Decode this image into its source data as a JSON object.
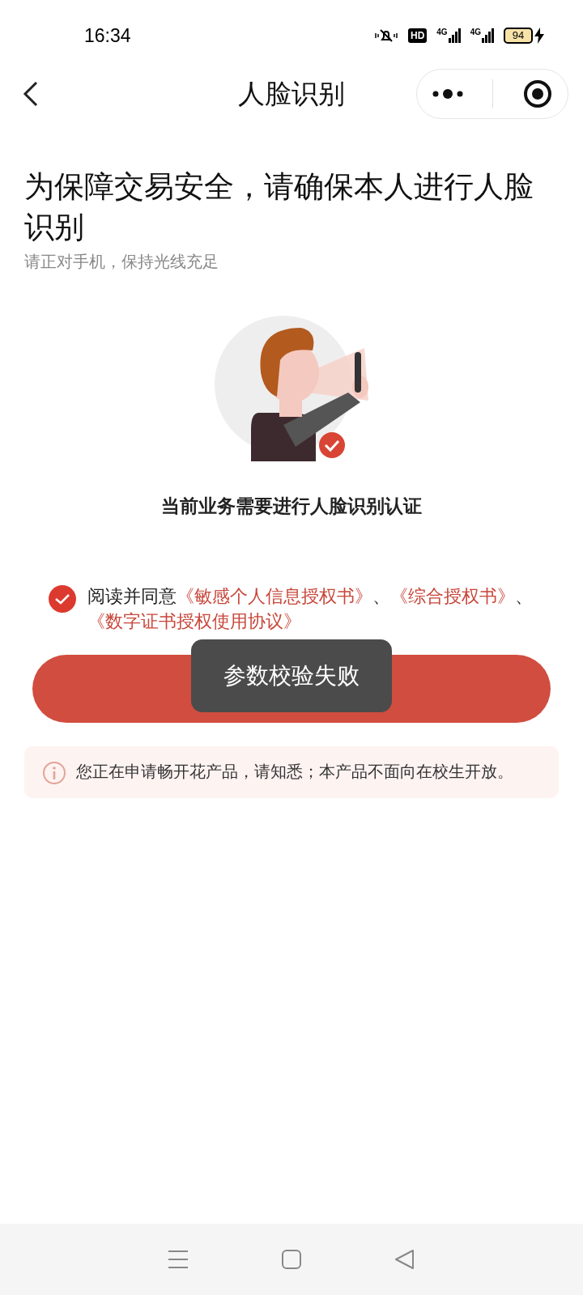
{
  "status_bar": {
    "time": "16:34",
    "hd": "HD",
    "networks": [
      "4G",
      "4G"
    ],
    "battery": "94",
    "charging": true
  },
  "nav": {
    "title": "人脸识别"
  },
  "heading": "为保障交易安全，请确保本人进行人脸识别",
  "subtitle": "请正对手机，保持光线充足",
  "caption": "当前业务需要进行人脸识别认证",
  "agreement": {
    "checked": true,
    "parts": [
      {
        "kind": "text",
        "text": "阅读并同意"
      },
      {
        "kind": "link",
        "text": "《敏感个人信息授权书》"
      },
      {
        "kind": "text",
        "text": "、"
      },
      {
        "kind": "link",
        "text": "《综合授权书》"
      },
      {
        "kind": "text",
        "text": "、"
      },
      {
        "kind": "link",
        "text": "《数字证书授权使用协议》"
      }
    ]
  },
  "notice": "您正在申请畅开花产品，请知悉；本产品不面向在校生开放。",
  "toast": "参数校验失败"
}
